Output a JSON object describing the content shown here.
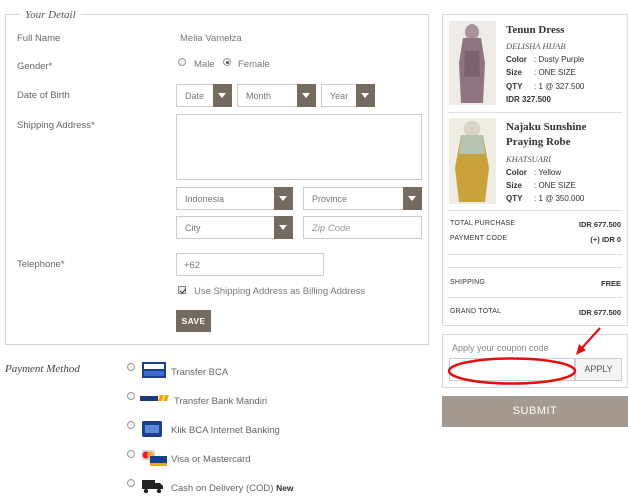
{
  "your_detail": {
    "legend": "Your Detail",
    "full_name_label": "Full Name",
    "full_name_value": "Melia Vamelza",
    "gender_label": "Gender*",
    "gender_male": "Male",
    "gender_female": "Female",
    "gender_selected": "Female",
    "dob_label": "Date of Birth",
    "dob_date": "Date",
    "dob_month": "Month",
    "dob_year": "Year",
    "shipping_address_label": "Shipping Address*",
    "shipping_address_value": "",
    "country": "Indonesia",
    "province": "Province",
    "city": "City",
    "zip_placeholder": "Zip Code",
    "telephone_label": "Telephone*",
    "telephone_value": "+62",
    "billing_checkbox_label": "Use Shipping Address as Billing Address",
    "billing_checked": true,
    "save_label": "SAVE"
  },
  "payment": {
    "title": "Payment Method",
    "options": [
      {
        "label": "Transfer BCA",
        "icon": "atm-bca-icon"
      },
      {
        "label": "Transfer Bank Mandiri",
        "icon": "mandiri-icon"
      },
      {
        "label": "Klik BCA Internet Banking",
        "icon": "klikbca-icon"
      },
      {
        "label": "Visa or Mastercard",
        "icon": "visa-mastercard-icon"
      },
      {
        "label": "Cash on Delivery (COD)",
        "badge": "New",
        "icon": "delivery-truck-icon"
      }
    ]
  },
  "cart": {
    "items": [
      {
        "title": "Tenun Dress",
        "brand": "DELISHA HIJAB",
        "color_label": "Color",
        "color_value": ": Dusty Purple",
        "size_label": "Size",
        "size_value": ": ONE SIZE",
        "qty_label": "QTY",
        "qty_value": ": 1 @ 327.500",
        "price": "IDR 327.500"
      },
      {
        "title_line1": "Najaku Sunshine",
        "title_line2": "Praying Robe",
        "brand": "KHATSUARI",
        "color_label": "Color",
        "color_value": ": Yellow",
        "size_label": "Size",
        "size_value": ": ONE SIZE",
        "qty_label": "QTY",
        "qty_value": ": 1 @ 350.000"
      }
    ],
    "total_purchase_label": "TOTAL PURCHASE",
    "total_purchase_value": "IDR 677.500",
    "payment_code_label": "PAYMENT CODE",
    "payment_code_value": "(+) IDR 0",
    "shipping_label": "SHIPPING",
    "shipping_value": "FREE",
    "grand_total_label": "GRAND TOTAL",
    "grand_total_value": "IDR 677.500"
  },
  "coupon": {
    "label": "Apply your coupon code",
    "value": "",
    "apply_label": "APPLY",
    "highlight_color": "#e01010"
  },
  "submit_label": "SUBMIT"
}
